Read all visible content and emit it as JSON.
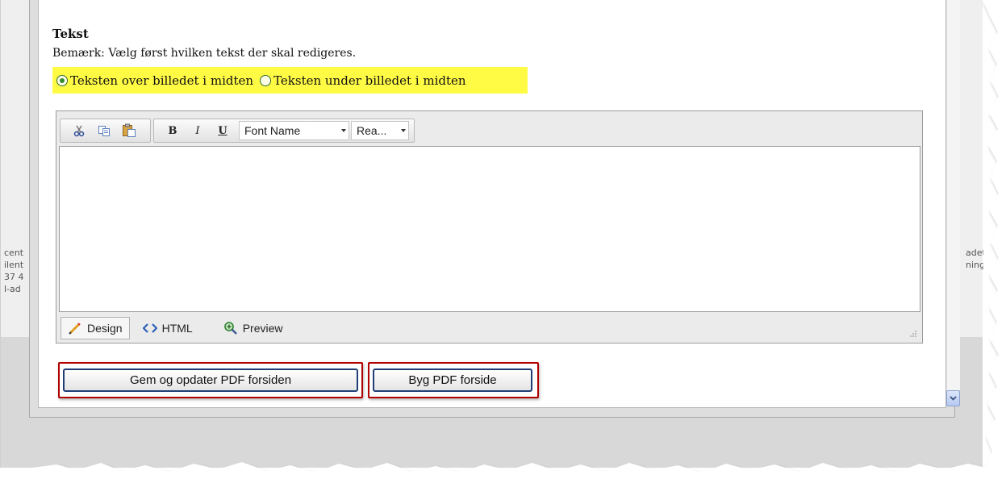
{
  "background": {
    "left_lines": [
      "cent",
      "ilent",
      "37 4",
      "l-ad"
    ],
    "right_lines": [
      "adet: C",
      "ningsmo"
    ]
  },
  "section": {
    "title": "Tekst",
    "note": "Bemærk: Vælg først hvilken tekst der skal redigeres.",
    "radio_options": [
      {
        "label": "Teksten over billedet i midten",
        "selected": true
      },
      {
        "label": "Teksten under billedet i midten",
        "selected": false
      }
    ],
    "highlight_color": "#fffb45"
  },
  "editor": {
    "toolbar": {
      "cut": "cut-icon",
      "copy": "copy-icon",
      "paste": "paste-icon",
      "bold": "B",
      "italic": "I",
      "underline": "U",
      "font_name": "Font Name",
      "font_size": "Rea..."
    },
    "content": "",
    "modes": {
      "design": "Design",
      "html": "HTML",
      "preview": "Preview"
    }
  },
  "buttons": {
    "save_update": "Gem og opdater PDF forsiden",
    "build": "Byg PDF forside"
  },
  "colors": {
    "button_highlight": "#b00000",
    "button_border": "#1f3e76"
  }
}
